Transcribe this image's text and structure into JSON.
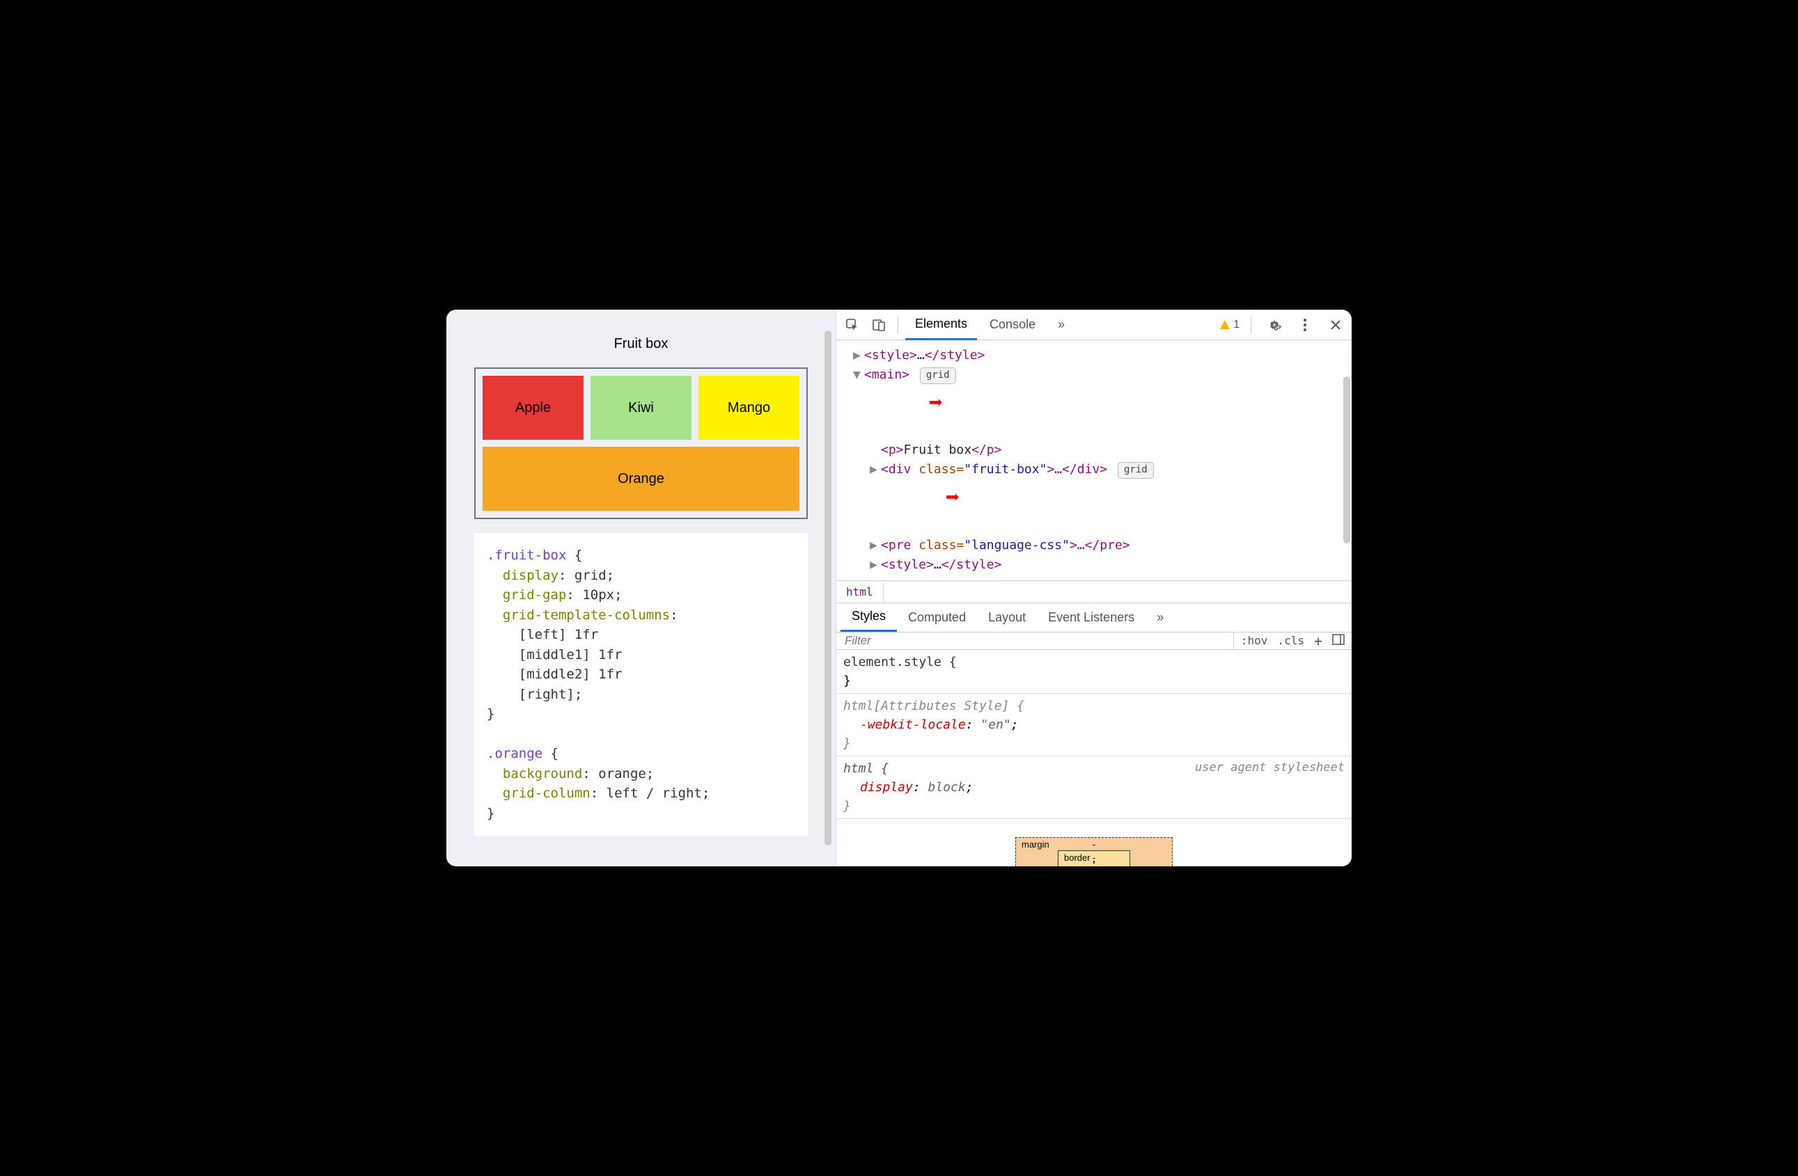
{
  "page": {
    "title": "Fruit box"
  },
  "fruits": {
    "apple": "Apple",
    "kiwi": "Kiwi",
    "mango": "Mango",
    "orange": "Orange"
  },
  "css_demo": {
    "sel1": ".fruit-box",
    "p1": "display",
    "v1": "grid",
    "p2": "grid-gap",
    "v2": "10px",
    "p3": "grid-template-columns",
    "l1": "[left] 1fr",
    "l2": "[middle1] 1fr",
    "l3": "[middle2] 1fr",
    "l4": "[right]",
    "sel2": ".orange",
    "p4": "background",
    "v4": "orange",
    "p5": "grid-column",
    "v5": "left / right"
  },
  "devtools": {
    "tabs": {
      "elements": "Elements",
      "console": "Console",
      "more": "»"
    },
    "warning_count": "1",
    "grid_badge": "grid",
    "dom": {
      "style_open": "<style>",
      "style_ell": "…",
      "style_close": "</style>",
      "main_open": "<main>",
      "p_open": "<p>",
      "p_text": "Fruit box",
      "p_close": "</p>",
      "div_open": "<div ",
      "div_attr": "class=",
      "div_val": "\"fruit-box\"",
      "div_rest": ">…</div>",
      "pre_open": "<pre ",
      "pre_attr": "class=",
      "pre_val": "\"language-css\"",
      "pre_rest": ">…</pre>",
      "style2_open": "<style>",
      "style2_ell": "…",
      "style2_close": "</style>"
    },
    "breadcrumb": "html",
    "styles_tabs": {
      "styles": "Styles",
      "computed": "Computed",
      "layout": "Layout",
      "listeners": "Event Listeners",
      "more": "»"
    },
    "filter_placeholder": "Filter",
    "filter_right": {
      "hov": ":hov",
      "cls": ".cls",
      "plus": "+"
    },
    "rules": {
      "r1_sel": "element.style {",
      "r1_close": "}",
      "r2_sel": "html[Attributes Style] {",
      "r2_prop": "-webkit-locale",
      "r2_val": "\"en\"",
      "r2_close": "}",
      "r3_sel": "html {",
      "r3_source": "user agent stylesheet",
      "r3_prop": "display",
      "r3_val": "block",
      "r3_close": "}"
    },
    "boxmodel": {
      "margin": "margin",
      "border": "border",
      "dash": "-"
    }
  }
}
